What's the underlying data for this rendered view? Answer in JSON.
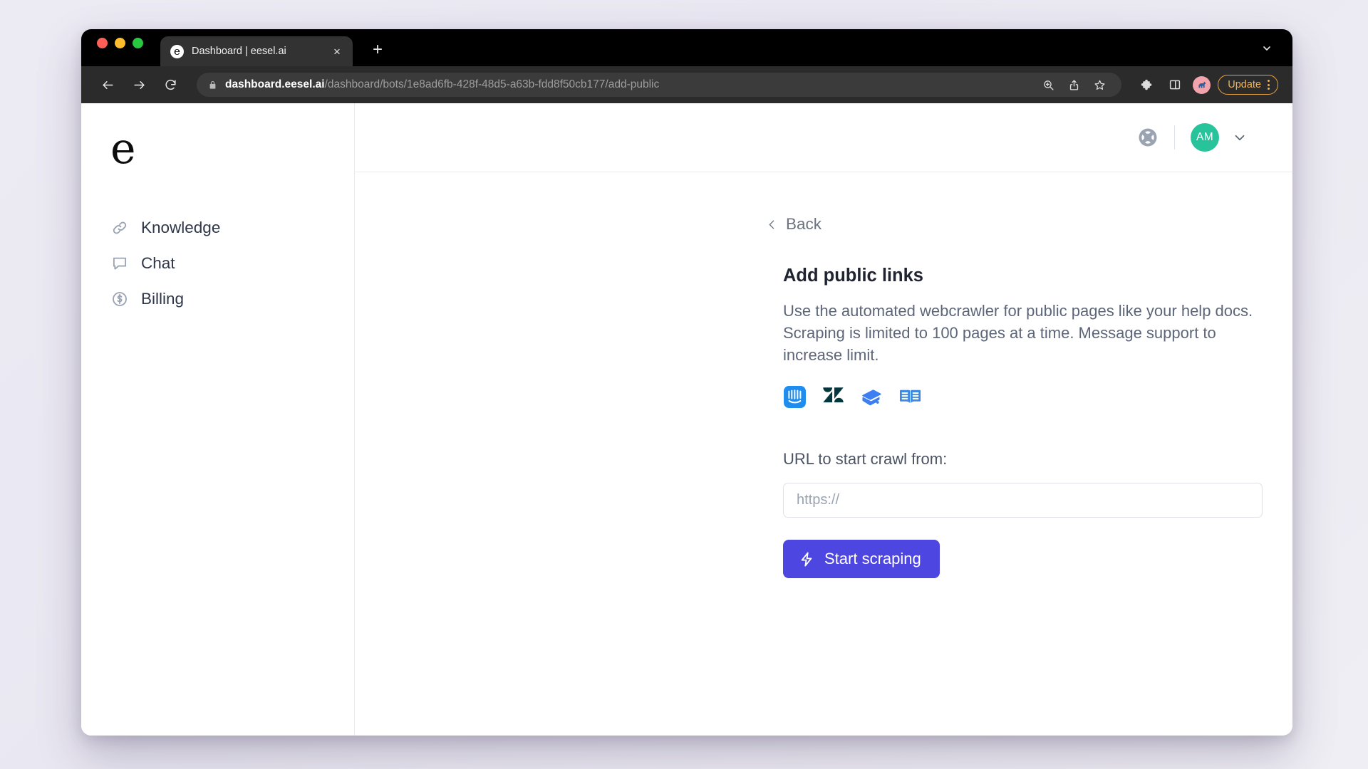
{
  "browser": {
    "tab": {
      "title": "Dashboard | eesel.ai",
      "favicon_letter": "e",
      "favicon_name": "eesel-favicon",
      "close_label": "×"
    },
    "new_tab_label": "+",
    "traffic_lights": {
      "close_color": "#ff5f57",
      "minimize_color": "#febc2e",
      "maximize_color": "#28c840"
    },
    "omnibox": {
      "host": "dashboard.eesel.ai",
      "path": "/dashboard/bots/1e8ad6fb-428f-48d5-a63b-fdd8f50cb177/add-public",
      "lock_icon": "lock-icon"
    },
    "toolbar_icons": [
      "back-icon",
      "forward-icon",
      "reload-icon",
      "zoom-icon",
      "share-icon",
      "bookmark-star-icon",
      "extensions-puzzle-icon",
      "sidebar-panel-icon",
      "profile-avatar-icon",
      "tab-list-chevron-icon"
    ],
    "update_button": {
      "label": "Update",
      "accent_color": "#e8a33d"
    }
  },
  "sidebar": {
    "brand_letter": "e",
    "items": [
      {
        "label": "Knowledge",
        "icon": "link-icon"
      },
      {
        "label": "Chat",
        "icon": "chat-bubble-icon"
      },
      {
        "label": "Billing",
        "icon": "dollar-circle-icon"
      }
    ]
  },
  "header": {
    "help_icon": "lifebuoy-help-icon",
    "avatar_initials": "AM",
    "avatar_color": "#27c39b",
    "chevron_icon": "chevron-down-icon"
  },
  "main": {
    "back_label": "Back",
    "title": "Add public links",
    "description": "Use the automated webcrawler for public pages like your help docs. Scraping is limited to 100 pages at a time. Message support to increase limit.",
    "integrations": [
      {
        "name": "intercom-icon",
        "color": "#1f8ded"
      },
      {
        "name": "zendesk-icon",
        "color": "#03363d"
      },
      {
        "name": "confluence-book-icon",
        "color": "#3d7ff2"
      },
      {
        "name": "document360-book-icon",
        "color": "#3d8ae0"
      }
    ],
    "url_field": {
      "label": "URL to start crawl from:",
      "value": "",
      "placeholder": "https://"
    },
    "submit_button": {
      "label": "Start scraping",
      "icon": "lightning-bolt-icon",
      "color": "#4e46e0"
    }
  }
}
